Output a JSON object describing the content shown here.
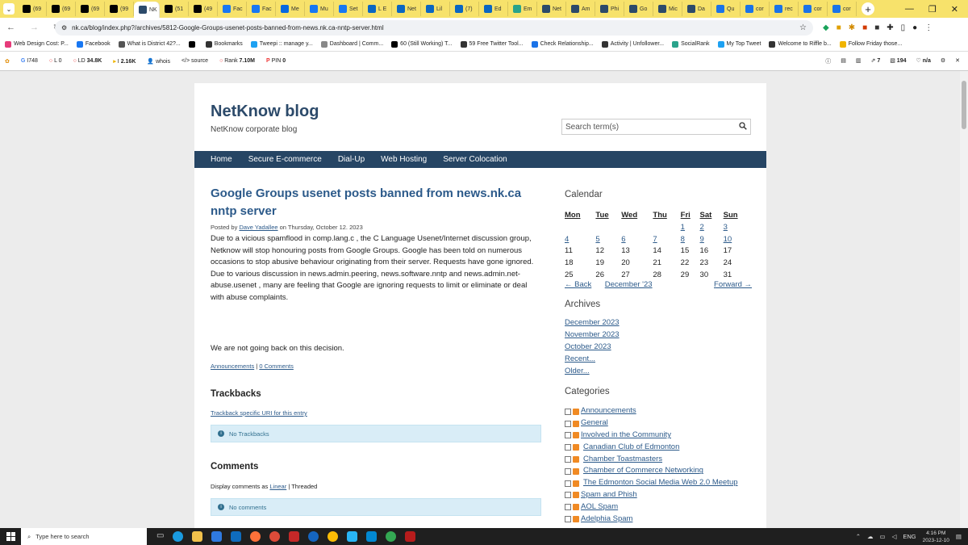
{
  "browser": {
    "tabs": [
      {
        "label": "(69",
        "icon": "x-icon",
        "color": "#000000"
      },
      {
        "label": "(69",
        "icon": "x-icon",
        "color": "#000000"
      },
      {
        "label": "(69",
        "icon": "x-icon",
        "color": "#000000"
      },
      {
        "label": "(99",
        "icon": "x-icon",
        "color": "#000000"
      },
      {
        "label": "NK",
        "icon": "netknow-icon",
        "color": "#2c4a6a",
        "active": true
      },
      {
        "label": "(51",
        "icon": "x-icon",
        "color": "#000000"
      },
      {
        "label": "(49",
        "icon": "x-icon",
        "color": "#000000"
      },
      {
        "label": "Fac",
        "icon": "facebook-icon",
        "color": "#1877f2"
      },
      {
        "label": "Fac",
        "icon": "facebook-icon",
        "color": "#1877f2"
      },
      {
        "label": "Me",
        "icon": "meta-icon",
        "color": "#0668e1"
      },
      {
        "label": "Mu",
        "icon": "facebook-icon",
        "color": "#1877f2"
      },
      {
        "label": "Set",
        "icon": "gear-icon",
        "color": "#1877f2"
      },
      {
        "label": "L E",
        "icon": "linkedin-icon",
        "color": "#0a66c2"
      },
      {
        "label": "Net",
        "icon": "linkedin-icon",
        "color": "#0a66c2"
      },
      {
        "label": "Lil",
        "icon": "linkedin-icon",
        "color": "#0a66c2"
      },
      {
        "label": "(7)",
        "icon": "linkedin-icon",
        "color": "#0a66c2"
      },
      {
        "label": "Ed",
        "icon": "linkedin-icon",
        "color": "#0a66c2"
      },
      {
        "label": "Em",
        "icon": "shield-icon",
        "color": "#2aa38b"
      },
      {
        "label": "Net",
        "icon": "netknow-icon",
        "color": "#2c4a6a"
      },
      {
        "label": "Am",
        "icon": "netknow-icon",
        "color": "#2c4a6a"
      },
      {
        "label": "Phi",
        "icon": "netknow-icon",
        "color": "#2c4a6a"
      },
      {
        "label": "Go",
        "icon": "netknow-icon",
        "color": "#2c4a6a"
      },
      {
        "label": "Mic",
        "icon": "netknow-icon",
        "color": "#2c4a6a"
      },
      {
        "label": "Da",
        "icon": "netknow-icon",
        "color": "#2c4a6a"
      },
      {
        "label": "Qu",
        "icon": "groups-icon",
        "color": "#1a73e8"
      },
      {
        "label": "cor",
        "icon": "groups-icon",
        "color": "#1a73e8"
      },
      {
        "label": "rec",
        "icon": "groups-icon",
        "color": "#1a73e8"
      },
      {
        "label": "cor",
        "icon": "groups-icon",
        "color": "#1a73e8"
      },
      {
        "label": "cor",
        "icon": "groups-icon",
        "color": "#1a73e8"
      }
    ],
    "url": "nk.ca/blog/index.php?/archives/5812-Google-Groups-usenet-posts-banned-from-news.nk.ca-nntp-server.html",
    "bookmarks": [
      {
        "label": "Web Design Cost: P...",
        "color": "#e63b7a"
      },
      {
        "label": "Facebook",
        "color": "#1877f2"
      },
      {
        "label": "What is District 42?...",
        "color": "#555555"
      },
      {
        "label": "",
        "color": "#000000"
      },
      {
        "label": "Bookmarks",
        "color": "#333333"
      },
      {
        "label": "Tweepi :: manage y...",
        "color": "#1da1f2"
      },
      {
        "label": "Dashboard | Comm...",
        "color": "#888888"
      },
      {
        "label": "60 (Still Working) T...",
        "color": "#000000"
      },
      {
        "label": "59 Free Twitter Tool...",
        "color": "#333333"
      },
      {
        "label": "Check Relationship...",
        "color": "#1a73e8"
      },
      {
        "label": "Activity | Unfollower...",
        "color": "#333333"
      },
      {
        "label": "SocialRank",
        "color": "#2aa38b"
      },
      {
        "label": "My Top Tweet",
        "color": "#1da1f2"
      },
      {
        "label": "Welcome to Riffle b...",
        "color": "#333333"
      },
      {
        "label": "Follow Friday those...",
        "color": "#f0b400"
      }
    ],
    "seo": {
      "g": "748",
      "l": "0",
      "ld": "34.8K",
      "i": "2.16K",
      "whois": "whois",
      "source": "source",
      "rank": "7.10M",
      "pin": "0",
      "right_a": "7",
      "right_b": "194",
      "right_c": "n/a"
    }
  },
  "site": {
    "title": "NetKnow blog",
    "description": "NetKnow corporate blog",
    "search_placeholder": "Search term(s)",
    "menu": [
      "Home",
      "Secure E-commerce",
      "Dial-Up",
      "Web Hosting",
      "Server Colocation"
    ]
  },
  "post": {
    "title": "Google Groups usenet posts banned from news.nk.ca nntp server",
    "posted_by": "Posted by",
    "author": "Dave Yadallee",
    "date": "on Thursday, October 12. 2023",
    "body": "Due to a vicious spamflood in comp.lang.c , the C Language Usenet/Internet discussion group, Netknow will stop honouring posts from Google Groups. Google has been told on numerous occasions to stop abusive behaviour originating from their server. Requests have gone ignored. Due to various discussion in news.admin.peering, news.software.nntp and news.admin.net-abuse.usenet , many are feeling that Google are ignoring requests to limit or eliminate or deal with abuse complaints.",
    "body2": "We are not going back on this decision.",
    "category": "Announcements",
    "sep": "|",
    "comments_link": "0 Comments",
    "trackbacks_heading": "Trackbacks",
    "trackback_link": "Trackback specific URI for this entry",
    "no_trackbacks": "No Trackbacks",
    "comments_heading": "Comments",
    "display_prefix": "Display comments as",
    "linear": "Linear",
    "threaded": "| Threaded",
    "no_comments": "No comments"
  },
  "sidebar": {
    "calendar_heading": "Calendar",
    "days": [
      "Mon",
      "Tue",
      "Wed",
      "Thu",
      "Fri",
      "Sat",
      "Sun"
    ],
    "weeks": [
      [
        "",
        "",
        "",
        "",
        "1",
        "2",
        "3"
      ],
      [
        "4",
        "5",
        "6",
        "7",
        "8",
        "9",
        "10"
      ],
      [
        "11",
        "12",
        "13",
        "14",
        "15",
        "16",
        "17"
      ],
      [
        "18",
        "19",
        "20",
        "21",
        "22",
        "23",
        "24"
      ],
      [
        "25",
        "26",
        "27",
        "28",
        "29",
        "30",
        "31"
      ]
    ],
    "back": "← Back",
    "month": "December '23",
    "forward": "Forward →",
    "archives_heading": "Archives",
    "archives": [
      "December 2023",
      "November 2023",
      "October 2023",
      "Recent...",
      "Older..."
    ],
    "categories_heading": "Categories",
    "categories": [
      "Announcements",
      "General",
      "Involved in the Community",
      "Canadian Club of Edmonton",
      "Chamber Toastmasters",
      "Chamber of Commerce Networking",
      "The Edmonton Social Media Web 2.0 Meetup",
      "Spam and Phish",
      "AOL Spam",
      "Adelphia Spam"
    ]
  },
  "taskbar": {
    "search_placeholder": "Type here to search",
    "lang": "ENG",
    "time": "4:16 PM",
    "date": "2023-12-10"
  }
}
